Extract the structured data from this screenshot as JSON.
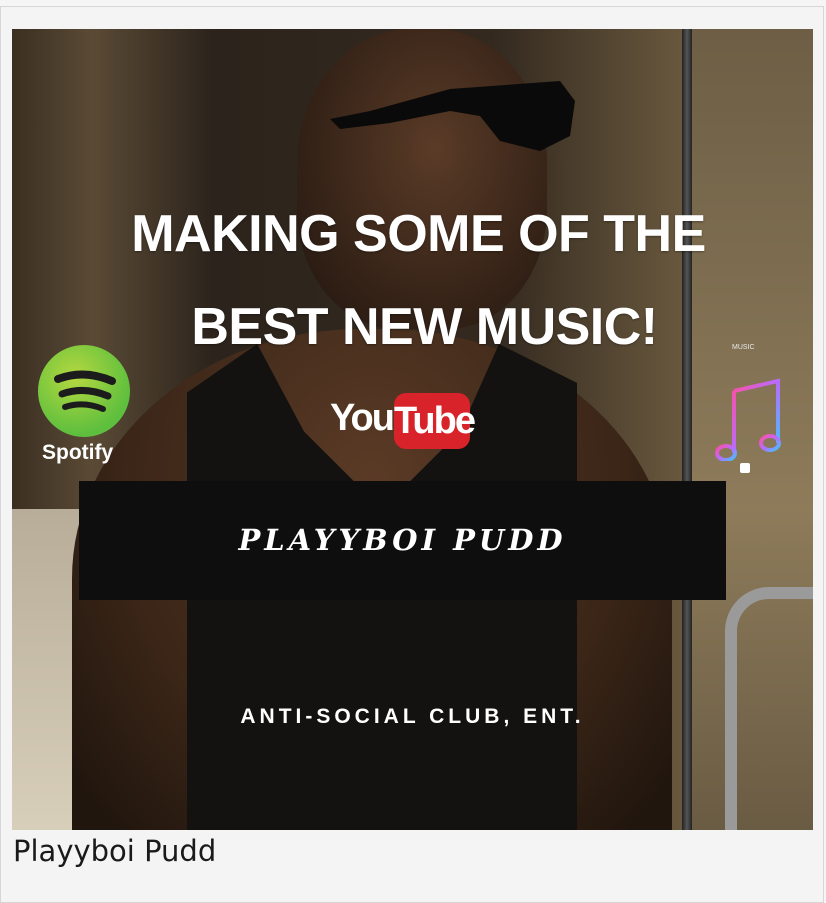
{
  "poster": {
    "headline_line1": "MAKING SOME OF THE",
    "headline_line2": "BEST NEW MUSIC!",
    "spotify_label": "Spotify",
    "youtube_you": "You",
    "youtube_tube": "Tube",
    "applemusic_label": "MUSIC",
    "artist_name": "PLAYYBOI PUDD",
    "tagline": "ANTI-SOCIAL CLUB, ENT."
  },
  "caption": "Playyboi Pudd",
  "colors": {
    "spotify_green": "#5ebf3e",
    "youtube_red": "#d8232a",
    "banner_black": "#0e0e0e"
  },
  "icons": [
    "spotify-logo-icon",
    "youtube-logo-icon",
    "apple-music-icon"
  ]
}
